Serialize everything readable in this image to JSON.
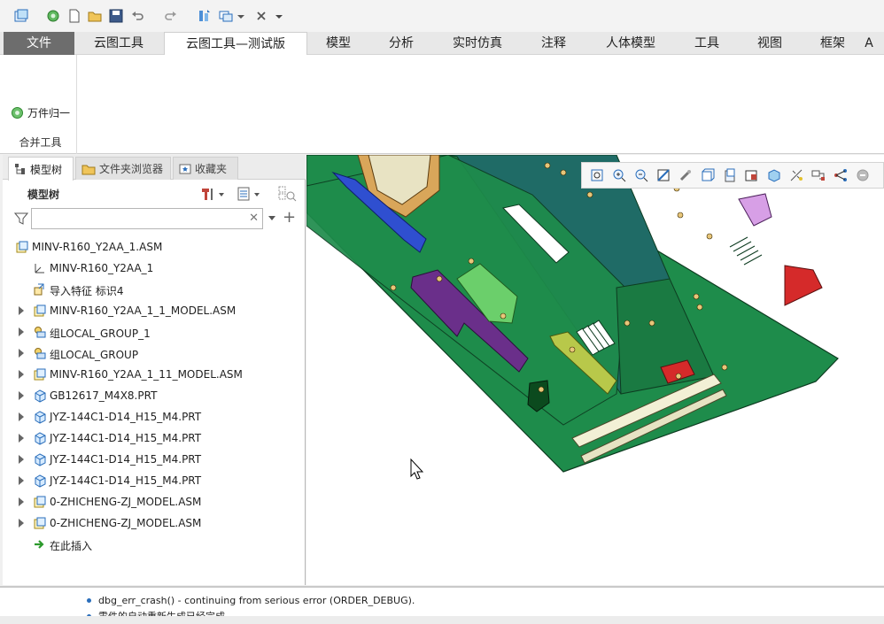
{
  "quick_access": {
    "icons": [
      "app-icon",
      "regen-icon",
      "new-file-icon",
      "open-folder-icon",
      "save-icon",
      "undo-icon",
      "redo-icon",
      "regenerate-icon",
      "windows-icon",
      "close-window-icon",
      "customize-dropdown-icon"
    ]
  },
  "tabs": [
    {
      "label": "文件"
    },
    {
      "label": "云图工具"
    },
    {
      "label": "云图工具—测试版"
    },
    {
      "label": "模型"
    },
    {
      "label": "分析"
    },
    {
      "label": "实时仿真"
    },
    {
      "label": "注释"
    },
    {
      "label": "人体模型"
    },
    {
      "label": "工具"
    },
    {
      "label": "视图"
    },
    {
      "label": "框架"
    },
    {
      "label": "A"
    }
  ],
  "ribbon": {
    "merge_button_label": "万件归一",
    "group_label": "合并工具"
  },
  "left_panel": {
    "tabs": [
      {
        "label": "模型树"
      },
      {
        "label": "文件夹浏览器"
      },
      {
        "label": "收藏夹"
      }
    ],
    "tree_header": "模型树",
    "filter_placeholder": "",
    "tree": [
      {
        "label": "MINV-R160_Y2AA_1.ASM",
        "icon": "assembly-icon",
        "expandable": false,
        "indent": 0
      },
      {
        "label": "MINV-R160_Y2AA_1",
        "icon": "coordinate-system-icon",
        "expandable": false,
        "indent": 1
      },
      {
        "label": "导入特征 标识4",
        "icon": "import-feature-icon",
        "expandable": false,
        "indent": 1
      },
      {
        "label": "MINV-R160_Y2AA_1_1_MODEL.ASM",
        "icon": "assembly-icon",
        "expandable": true,
        "indent": 1
      },
      {
        "label": "组LOCAL_GROUP_1",
        "icon": "group-icon",
        "expandable": true,
        "indent": 1
      },
      {
        "label": "组LOCAL_GROUP",
        "icon": "group-icon",
        "expandable": true,
        "indent": 1
      },
      {
        "label": "MINV-R160_Y2AA_1_11_MODEL.ASM",
        "icon": "assembly-icon",
        "expandable": true,
        "indent": 1
      },
      {
        "label": "GB12617_M4X8.PRT",
        "icon": "part-icon",
        "expandable": true,
        "indent": 1
      },
      {
        "label": "JYZ-144C1-D14_H15_M4.PRT",
        "icon": "part-icon",
        "expandable": true,
        "indent": 1
      },
      {
        "label": "JYZ-144C1-D14_H15_M4.PRT",
        "icon": "part-icon",
        "expandable": true,
        "indent": 1
      },
      {
        "label": "JYZ-144C1-D14_H15_M4.PRT",
        "icon": "part-icon",
        "expandable": true,
        "indent": 1
      },
      {
        "label": "JYZ-144C1-D14_H15_M4.PRT",
        "icon": "part-icon",
        "expandable": true,
        "indent": 1
      },
      {
        "label": "0-ZHICHENG-ZJ_MODEL.ASM",
        "icon": "assembly-icon",
        "expandable": true,
        "indent": 1
      },
      {
        "label": "0-ZHICHENG-ZJ_MODEL.ASM",
        "icon": "assembly-icon",
        "expandable": true,
        "indent": 1
      },
      {
        "label": "在此插入",
        "icon": "insert-here-arrow-icon",
        "expandable": false,
        "indent": 1
      }
    ]
  },
  "view_toolbar": {
    "icons": [
      "refit-icon",
      "zoom-in-icon",
      "zoom-out-icon",
      "repaint-icon",
      "spin-center-icon",
      "display-style-icon",
      "saved-orientations-icon",
      "view-manager-icon",
      "perspective-icon",
      "datum-display-icon",
      "annotation-display-icon",
      "network-icon",
      "stop-icon"
    ]
  },
  "messages": [
    "dbg_err_crash() - continuing from serious error (ORDER_DEBUG).",
    "零件的自动重新生成已经完成。"
  ],
  "colors": {
    "model_green": "#1e8c4b",
    "model_teal": "#1f6b66",
    "accent_blue": "#2a6ebb",
    "file_tab": "#6d6d6d"
  }
}
